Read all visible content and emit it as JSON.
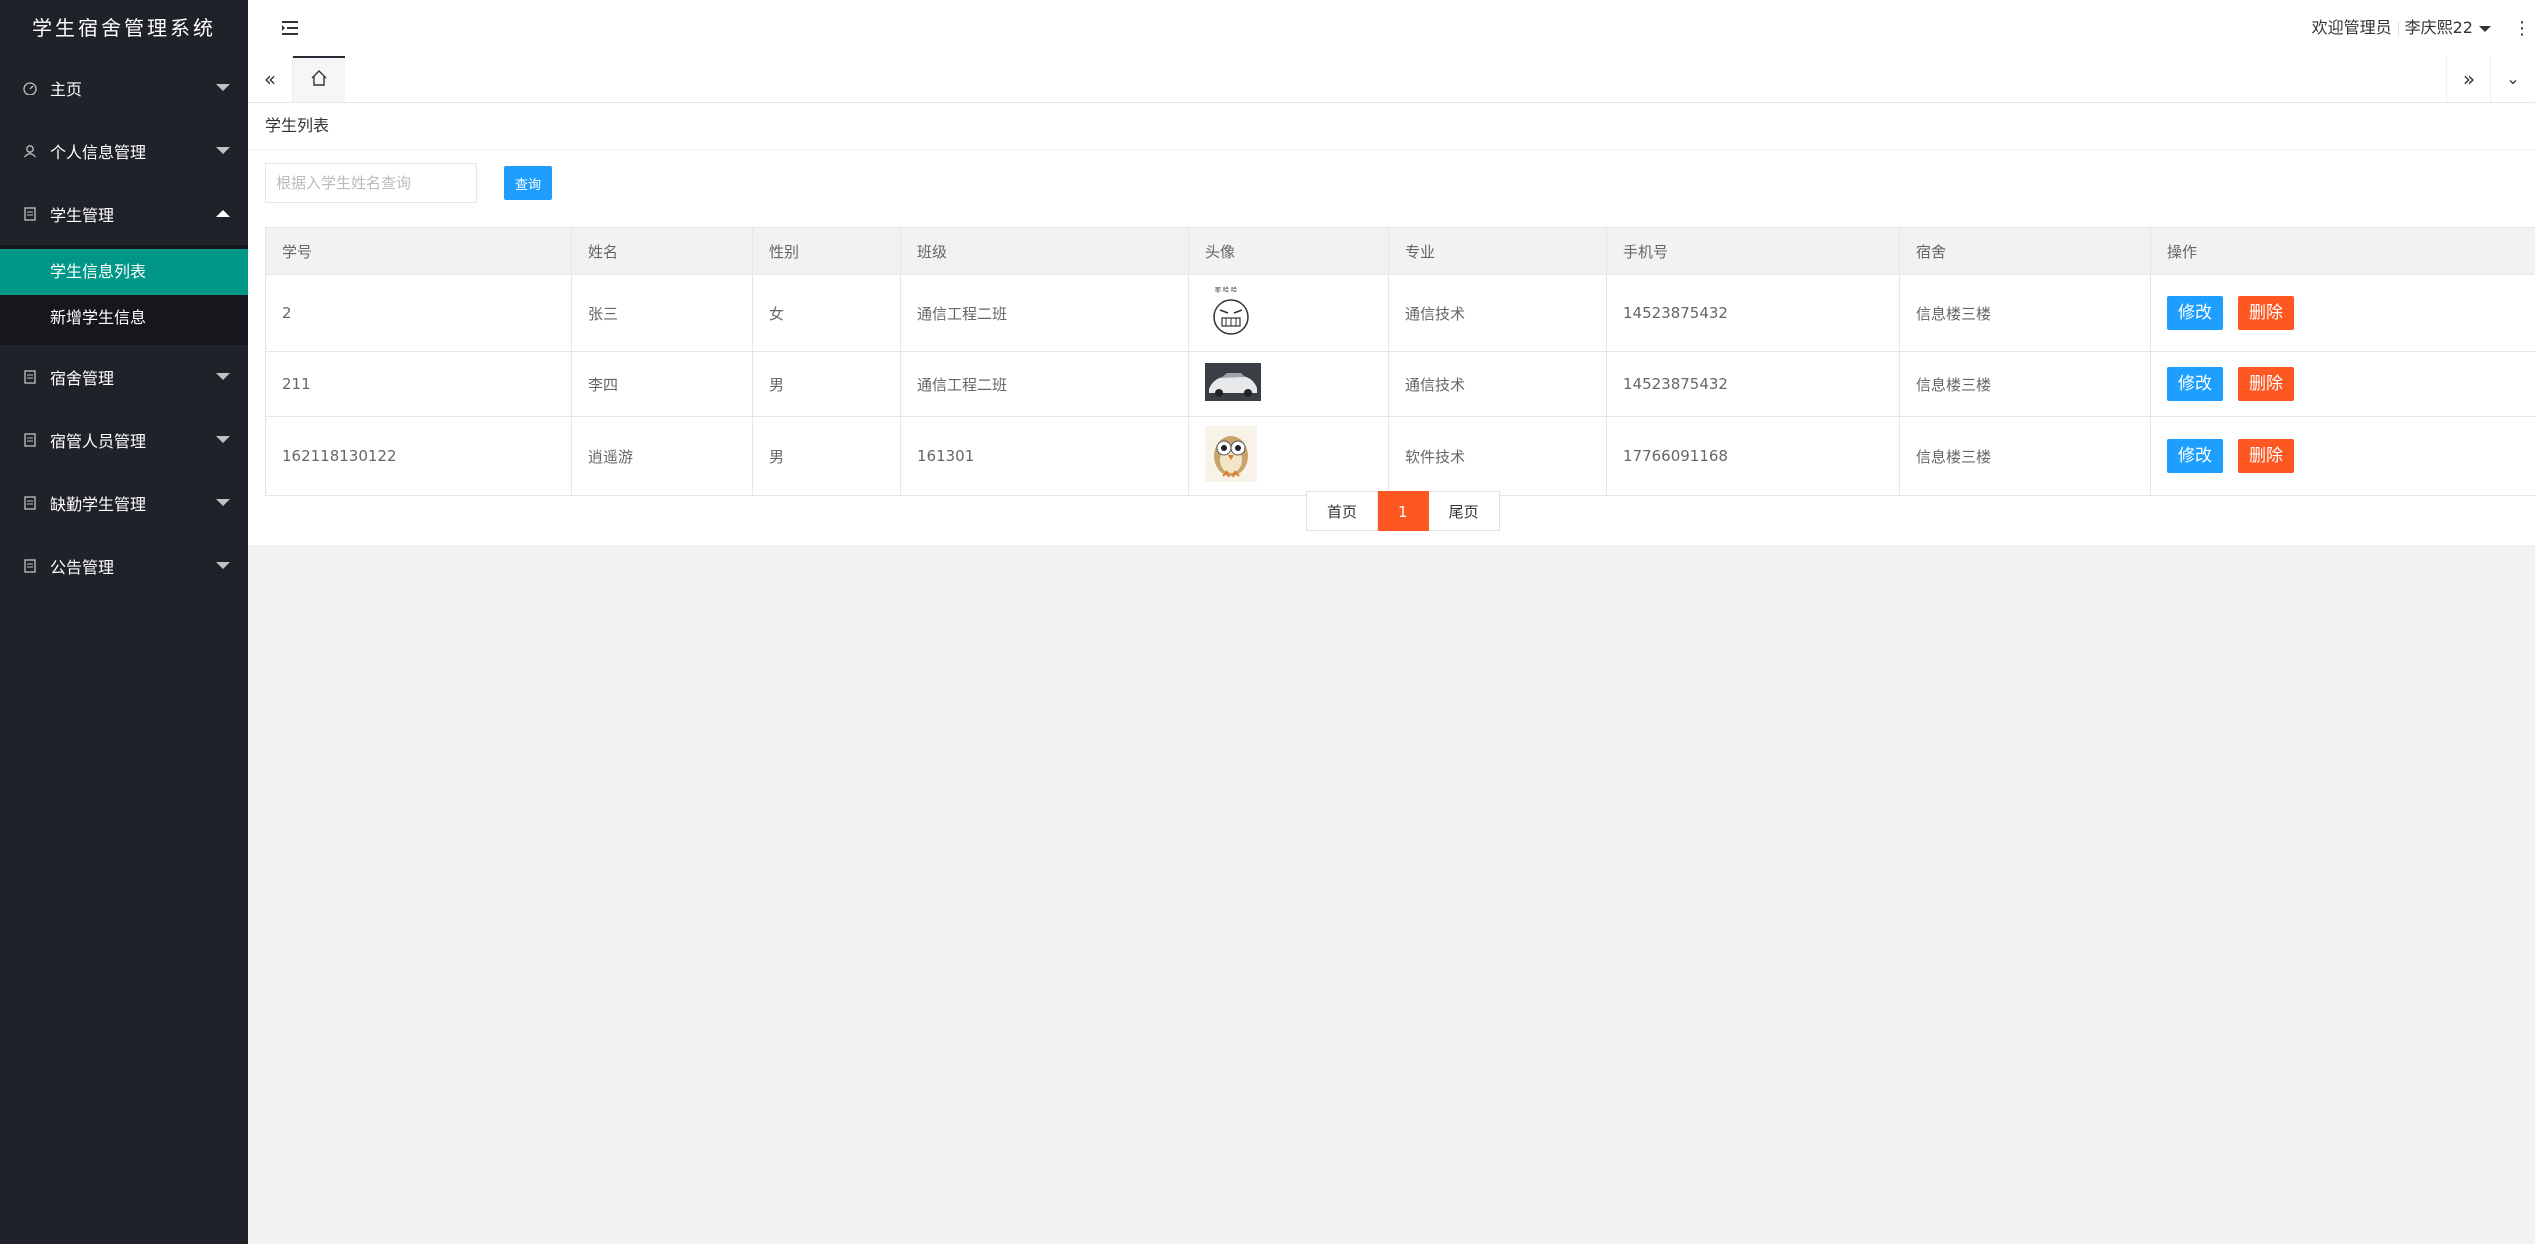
{
  "app": {
    "title": "学生宿舍管理系统"
  },
  "sidebar": {
    "items": [
      {
        "label": "主页",
        "icon": "dashboard-icon"
      },
      {
        "label": "个人信息管理",
        "icon": "user-icon"
      },
      {
        "label": "学生管理",
        "icon": "file-icon",
        "expanded": true,
        "children": [
          {
            "label": "学生信息列表",
            "selected": true
          },
          {
            "label": "新增学生信息"
          }
        ]
      },
      {
        "label": "宿舍管理",
        "icon": "file-icon"
      },
      {
        "label": "宿管人员管理",
        "icon": "file-icon"
      },
      {
        "label": "缺勤学生管理",
        "icon": "file-icon"
      },
      {
        "label": "公告管理",
        "icon": "file-icon"
      }
    ]
  },
  "header": {
    "welcome": "欢迎管理员",
    "username": "李庆熙22"
  },
  "card": {
    "title": "学生列表",
    "search_placeholder": "根据入学生姓名查询",
    "search_button": "查询"
  },
  "table": {
    "columns": [
      "学号",
      "姓名",
      "性别",
      "班级",
      "头像",
      "专业",
      "手机号",
      "宿舍",
      "操作"
    ],
    "rows": [
      {
        "id": "2",
        "name": "张三",
        "gender": "女",
        "class": "通信工程二班",
        "avatar": "meme-face",
        "major": "通信技术",
        "phone": "14523875432",
        "dorm": "信息楼三楼"
      },
      {
        "id": "211",
        "name": "李四",
        "gender": "男",
        "class": "通信工程二班",
        "avatar": "car",
        "major": "通信技术",
        "phone": "14523875432",
        "dorm": "信息楼三楼"
      },
      {
        "id": "162118130122",
        "name": "逍遥游",
        "gender": "男",
        "class": "161301",
        "avatar": "owl",
        "major": "软件技术",
        "phone": "17766091168",
        "dorm": "信息楼三楼"
      }
    ],
    "edit_label": "修改",
    "delete_label": "删除"
  },
  "pager": {
    "first": "首页",
    "current": "1",
    "last": "尾页"
  },
  "colors": {
    "sidebar_bg": "#20222a",
    "selected": "#009688",
    "primary": "#1e9fff",
    "danger": "#ff5722"
  }
}
